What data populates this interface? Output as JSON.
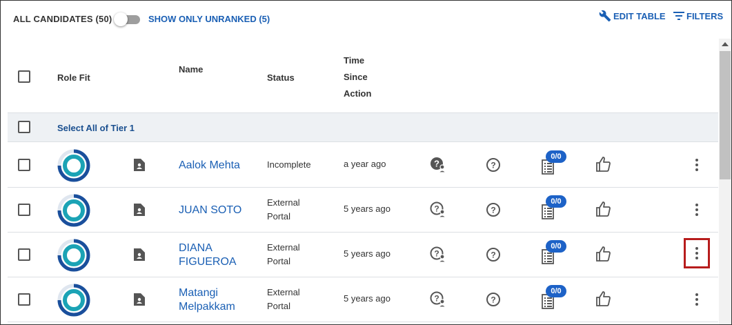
{
  "toolbar": {
    "all_candidates": "ALL CANDIDATES (50)",
    "show_unranked": "SHOW ONLY UNRANKED (5)",
    "edit_table": "EDIT TABLE",
    "filters": "FILTERS",
    "unranked_toggle_on": false
  },
  "columns": {
    "role_fit": "Role Fit",
    "name": "Name",
    "status": "Status",
    "time_since_action": [
      "Time",
      "Since",
      "Action"
    ]
  },
  "tier": {
    "select_all": "Select All of Tier 1"
  },
  "candidates": [
    {
      "name": [
        "Aalok Mehta"
      ],
      "status": [
        "Incomplete"
      ],
      "time": "a year ago",
      "badge": "0/0",
      "q_person_filled": true
    },
    {
      "name": [
        "JUAN SOTO"
      ],
      "status": [
        "External",
        "Portal"
      ],
      "time": "5 years ago",
      "badge": "0/0",
      "q_person_filled": false
    },
    {
      "name": [
        "DIANA",
        "FIGUEROA"
      ],
      "status": [
        "External",
        "Portal"
      ],
      "time": "5 years ago",
      "badge": "0/0",
      "q_person_filled": false
    },
    {
      "name": [
        "Matangi",
        "Melpakkam"
      ],
      "status": [
        "External",
        "Portal"
      ],
      "time": "5 years ago",
      "badge": "0/0",
      "q_person_filled": false
    }
  ],
  "colors": {
    "link": "#1a5fb4",
    "badge": "#1d62c7",
    "ring_outer": "#1a4f9c",
    "ring_inner": "#1ba3b5",
    "highlight": "#b71c1c"
  }
}
